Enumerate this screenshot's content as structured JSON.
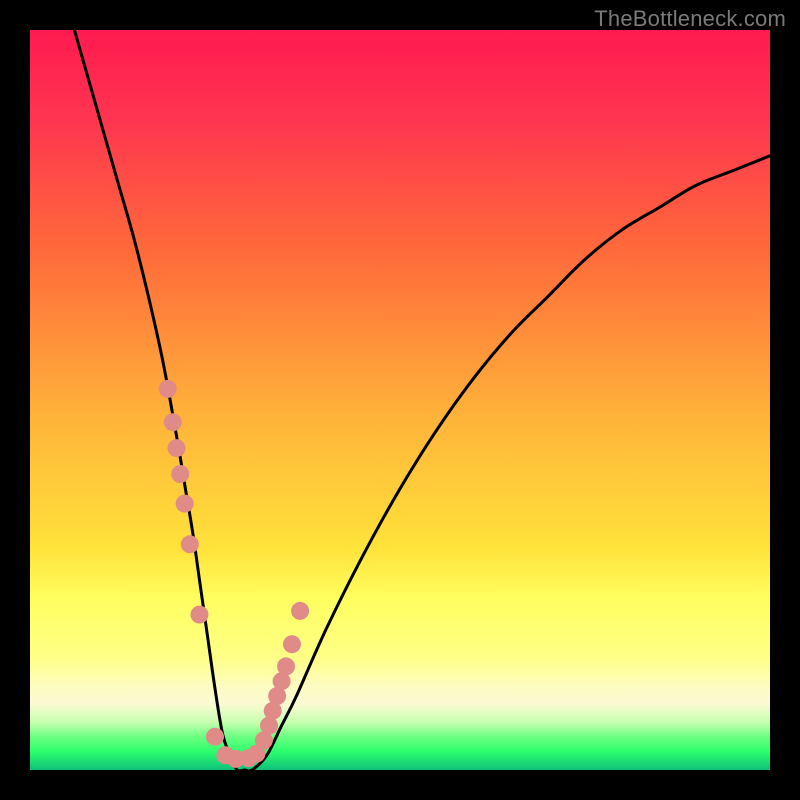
{
  "watermark": "TheBottleneck.com",
  "colors": {
    "background": "#000000",
    "dot": "#e08b87",
    "dot_stroke": "#d97e7a",
    "curve": "#000000",
    "gradient_top": "#ff1a4f",
    "gradient_mid1": "#ff6a3a",
    "gradient_mid2": "#ffd23a",
    "gradient_mid3": "#ffff60",
    "gradient_ivory": "#fbfad2",
    "gradient_green": "#2cff6b",
    "gradient_teal": "#0fbf7a"
  },
  "chart_data": {
    "type": "line",
    "title": "",
    "xlabel": "",
    "ylabel": "",
    "xlim": [
      0,
      100
    ],
    "ylim": [
      0,
      100
    ],
    "grid": false,
    "legend": false,
    "series": [
      {
        "name": "bottleneck-curve",
        "x": [
          6,
          8,
          10,
          12,
          14,
          16,
          18,
          20,
          21,
          22,
          23,
          24,
          25,
          26,
          27,
          28,
          29,
          30,
          32,
          34,
          36,
          40,
          45,
          50,
          55,
          60,
          65,
          70,
          75,
          80,
          85,
          90,
          95,
          100
        ],
        "y": [
          100,
          93,
          86,
          79,
          72,
          64,
          55,
          44,
          38,
          32,
          25,
          18,
          11,
          5,
          2,
          0,
          0,
          0,
          2,
          6,
          10,
          19,
          29,
          38,
          46,
          53,
          59,
          64,
          69,
          73,
          76,
          79,
          81,
          83
        ]
      }
    ],
    "dots": {
      "name": "highlight-points",
      "x": [
        18.6,
        19.3,
        19.8,
        20.3,
        20.9,
        21.6,
        22.9,
        25.0,
        26.4,
        27.8,
        29.5,
        30.6,
        31.6,
        32.3,
        32.8,
        33.4,
        34.0,
        34.6,
        35.4,
        36.5
      ],
      "y": [
        51.5,
        47.0,
        43.5,
        40.0,
        36.0,
        30.5,
        21.0,
        4.5,
        2.0,
        1.5,
        1.6,
        2.2,
        4.0,
        6.0,
        8.0,
        10.0,
        12.0,
        14.0,
        17.0,
        21.5
      ]
    },
    "gradient_bands": [
      {
        "from_y": 100,
        "to_y": 23,
        "type": "smooth",
        "stops": [
          "#ff1a4f",
          "#ff6a3a",
          "#ffd23a",
          "#ffff60"
        ]
      },
      {
        "from_y": 23,
        "to_y": 12,
        "color": "#ffff60"
      },
      {
        "from_y": 12,
        "to_y": 6,
        "color": "#fbfad2"
      },
      {
        "from_y": 6,
        "to_y": 2,
        "type": "smooth",
        "stops": [
          "#7aff8a",
          "#2cff6b"
        ]
      },
      {
        "from_y": 2,
        "to_y": 0,
        "color": "#0fbf7a"
      }
    ]
  }
}
